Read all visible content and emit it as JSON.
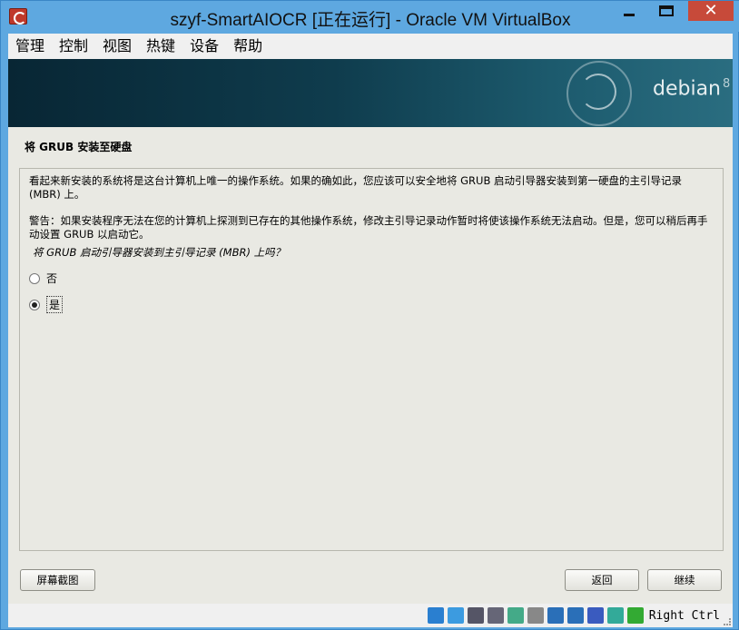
{
  "window": {
    "title": "szyf-SmartAIOCR [正在运行] - Oracle VM VirtualBox",
    "close_symbol": "✕"
  },
  "menu": [
    "管理",
    "控制",
    "视图",
    "热键",
    "设备",
    "帮助"
  ],
  "banner": {
    "brand": "debian",
    "version": "8"
  },
  "installer": {
    "section_title": "将 GRUB 安装至硬盘",
    "paragraph1": "看起来新安装的系统将是这台计算机上唯一的操作系统。如果的确如此，您应该可以安全地将 GRUB 启动引导器安装到第一硬盘的主引导记录 (MBR) 上。",
    "paragraph2": "警告：如果安装程序无法在您的计算机上探测到已存在的其他操作系统，修改主引导记录动作暂时将使该操作系统无法启动。但是，您可以稍后再手动设置 GRUB 以启动它。",
    "question": "将 GRUB 启动引导器安装到主引导记录 (MBR) 上吗？",
    "option_no": "否",
    "option_yes": "是",
    "selected": "是"
  },
  "buttons": {
    "screenshot": "屏幕截图",
    "back": "返回",
    "continue": "继续"
  },
  "statusbar": {
    "icons": [
      "hard-disk-icon",
      "optical-disk-icon",
      "audio-icon",
      "network-icon",
      "usb-icon",
      "shared-folders-icon",
      "display-icon",
      "video-capture-icon",
      "virtualization-icon",
      "mouse-integration-icon",
      "arrow-down-icon"
    ],
    "icon_colors": [
      "#2a7fd0",
      "#3c9be0",
      "#556",
      "#667",
      "#4a8",
      "#888",
      "#2a6fb8",
      "#2a6fb8",
      "#3a5bbf",
      "#3a9",
      "#3a3"
    ],
    "host_key": "Right Ctrl"
  }
}
